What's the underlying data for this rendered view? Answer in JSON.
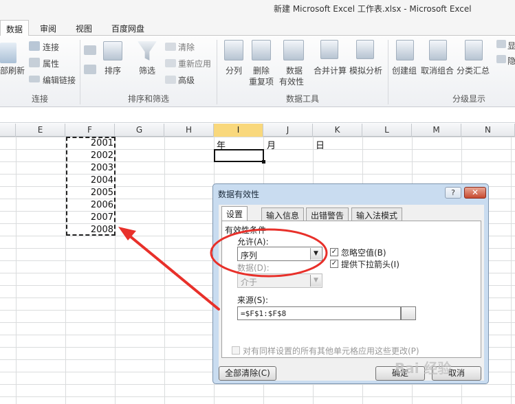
{
  "window": {
    "title": "新建 Microsoft Excel 工作表.xlsx - Microsoft Excel"
  },
  "ribbon_tabs": [
    "数据",
    "审阅",
    "视图",
    "百度网盘"
  ],
  "ribbon": {
    "connections": {
      "refresh_all": "部刷新",
      "connections": "连接",
      "properties": "属性",
      "edit_links": "编辑链接",
      "group": "连接"
    },
    "sort_filter": {
      "sort": "排序",
      "filter": "筛选",
      "clear": "清除",
      "reapply": "重新应用",
      "advanced": "高级",
      "group": "排序和筛选"
    },
    "data_tools": {
      "text_to_columns": "分列",
      "remove_dup_1": "删除",
      "remove_dup_2": "重复项",
      "validation_1": "数据",
      "validation_2": "有效性",
      "consolidate": "合并计算",
      "what_if": "模拟分析",
      "group": "数据工具"
    },
    "outline": {
      "group_btn": "创建组",
      "ungroup_btn": "取消组合",
      "subtotal": "分类汇总",
      "show_detail": "显",
      "hide_detail": "隐",
      "group": "分级显示"
    }
  },
  "columns": [
    "E",
    "F",
    "G",
    "H",
    "I",
    "J",
    "K",
    "L",
    "M",
    "N"
  ],
  "selected_column": "I",
  "cells": {
    "years": [
      "2001",
      "2002",
      "2003",
      "2004",
      "2005",
      "2006",
      "2007",
      "2008"
    ],
    "i_header": "年",
    "j_header": "月",
    "k_header": "日"
  },
  "dialog": {
    "title": "数据有效性",
    "help": "?",
    "close": "✕",
    "tabs": [
      "设置",
      "输入信息",
      "出错警告",
      "输入法模式"
    ],
    "section": "有效性条件",
    "allow_label": "允许(A):",
    "allow_value": "序列",
    "ignore_blank": "忽略空值(B)",
    "ignore_blank_checked": true,
    "dropdown_arrow": "提供下拉箭头(I)",
    "dropdown_arrow_checked": true,
    "data_label": "数据(D):",
    "data_value": "介于",
    "source_label": "来源(S):",
    "source_value": "=$F$1:$F$8",
    "apply_all": "对有同样设置的所有其他单元格应用这些更改(P)",
    "clear_all": "全部清除(C)",
    "ok": "确定",
    "cancel": "取消"
  },
  "watermark": "Bai 经验",
  "colors": {
    "annotation": "#e8302a",
    "selected_col": "#f9d87c",
    "dialog_frame": "#c9dcf0"
  }
}
